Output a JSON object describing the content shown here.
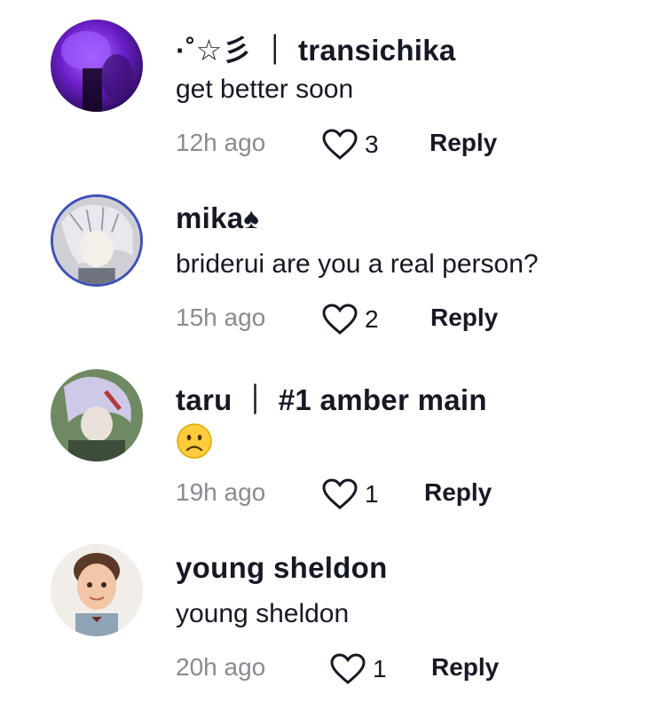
{
  "comments": [
    {
      "username": "·̩̩̥͙＊*•̩̩͙✩•̩̩͙*˚ ⋆ ✮ ｜ transichika",
      "username_display": "·˚☆彡 ｜ transichika",
      "text": "get better soon",
      "time": "12h ago",
      "likes": "3",
      "reply_label": "Reply"
    },
    {
      "username": "mika♠",
      "text": "briderui are you a real person?",
      "time": "15h ago",
      "likes": "2",
      "reply_label": "Reply"
    },
    {
      "username": "taru ｜ #1  amber  main",
      "text": "",
      "emoji": "slightly-frowning-face",
      "time": "19h ago",
      "likes": "1",
      "reply_label": "Reply"
    },
    {
      "username": "young sheldon",
      "text": "young sheldon",
      "time": "20h ago",
      "likes": "1",
      "reply_label": "Reply"
    }
  ],
  "colors": {
    "text": "#161823",
    "muted": "#8a8b91",
    "avatar_ring_mika": "#3f51b5"
  }
}
